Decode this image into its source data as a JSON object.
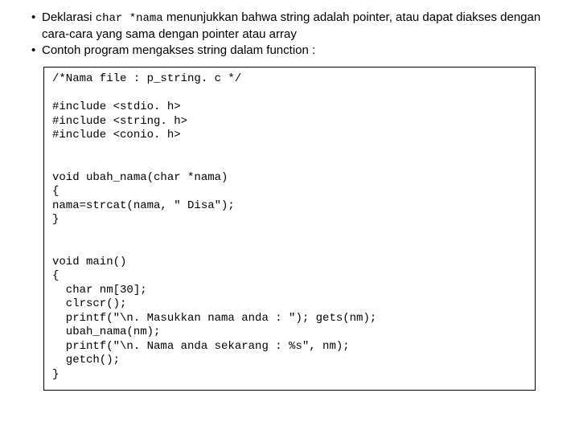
{
  "bullets": {
    "b1_prefix": "Deklarasi ",
    "b1_code": "char *nama",
    "b1_suffix": " menunjukkan bahwa string adalah pointer, atau dapat diakses dengan cara-cara yang sama dengan pointer atau array",
    "b2": "Contoh program mengakses string dalam function :"
  },
  "code": {
    "block1": "/*Nama file : p_string. c */",
    "block2": "#include <stdio. h>\n#include <string. h>\n#include <conio. h>",
    "block3": "void ubah_nama(char *nama)\n{\nnama=strcat(nama, \" Disa\");\n}",
    "block4": "void main()\n{\n  char nm[30];\n  clrscr();\n  printf(\"\\n. Masukkan nama anda : \"); gets(nm);\n  ubah_nama(nm);\n  printf(\"\\n. Nama anda sekarang : %s\", nm);\n  getch();\n}"
  }
}
